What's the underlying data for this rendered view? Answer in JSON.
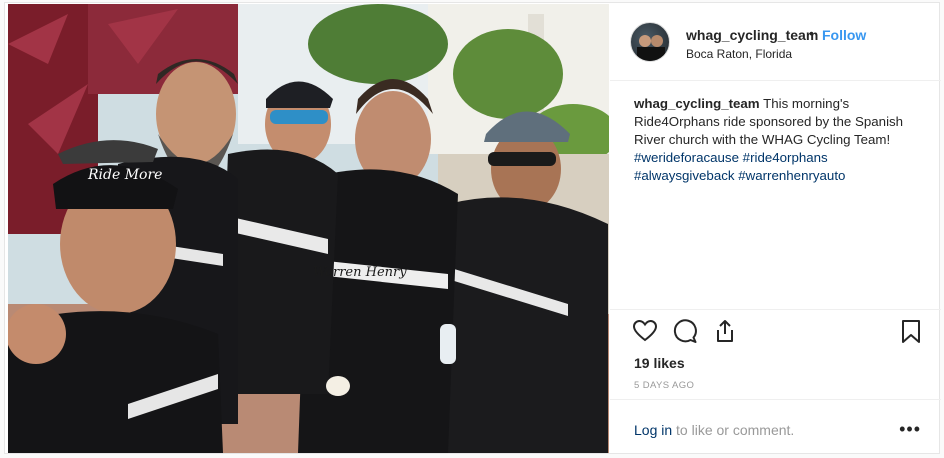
{
  "post": {
    "username": "whag_cycling_team",
    "separator": "•",
    "follow_label": "Follow",
    "location": "Boca Raton, Florida",
    "caption_text": "This morning's Ride4Orphans ride sponsored by the Spanish River church with the WHAG Cycling Team!",
    "hashtags": [
      "#werideforacause",
      "#ride4orphans",
      "#alwaysgiveback",
      "#warrenhenryauto"
    ],
    "likes": "19 likes",
    "time_ago": "5 DAYS AGO",
    "login_link": "Log in",
    "comment_prompt": " to like or comment.",
    "more_label": "•••"
  },
  "photo": {
    "cap_text": "Ride More",
    "jersey_text": "Warren Henry"
  },
  "colors": {
    "link_blue": "#3897f0",
    "hashtag_navy": "#003569",
    "muted": "#999999"
  },
  "icons": [
    "heart-icon",
    "comment-icon",
    "share-icon",
    "bookmark-icon"
  ]
}
